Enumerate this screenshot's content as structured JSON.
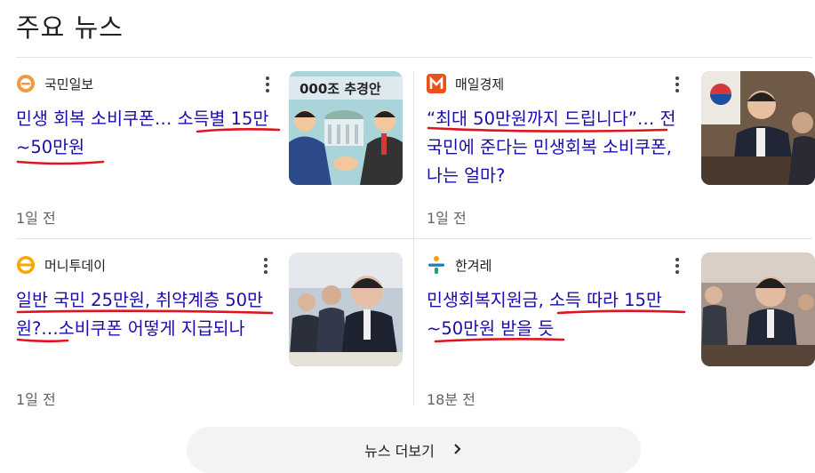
{
  "section": {
    "title": "주요 뉴스"
  },
  "articles": [
    {
      "source": "국민일보",
      "headline_plain": "민생 회복 소비쿠폰… ",
      "headline_marked": "소득별 15만~50만원",
      "time": "1일 전",
      "thumb_text": "000조 추경안"
    },
    {
      "source": "매일경제",
      "headline_marked": "“최대 50만원까지 드립니다”…",
      "headline_plain": " 전국민에 준다는 민생회복 소비쿠폰, 나는 얼마?",
      "time": "1일 전"
    },
    {
      "source": "머니투데이",
      "headline_marked": "일반 국민 25만원, 취약계층 50만원?",
      "headline_plain": "…소비쿠폰 어떻게 지급되나",
      "time": "1일 전"
    },
    {
      "source": "한겨레",
      "headline_plain": "민생회복지원금, ",
      "headline_marked": "소득 따라 15만~50만원 받을 듯",
      "time": "18분 전"
    }
  ],
  "footer": {
    "more_label": "뉴스 더보기"
  },
  "colors": {
    "link": "#1a0dab",
    "annotation": "#e0141e",
    "divider": "#e3e3e3"
  },
  "icons": {
    "more": "more-vert-icon",
    "chevron": "chevron-right-icon"
  }
}
